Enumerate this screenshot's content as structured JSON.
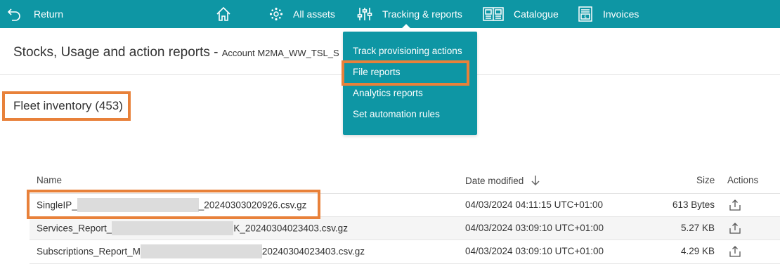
{
  "topbar": {
    "return_label": "Return",
    "home_icon": "home-icon",
    "all_assets_label": "All assets",
    "tracking_label": "Tracking & reports",
    "catalogue_label": "Catalogue",
    "invoices_label": "Invoices",
    "accent_color": "#0e96a4"
  },
  "dropdown": {
    "items": [
      {
        "label": "Track provisioning actions"
      },
      {
        "label": "File reports",
        "highlighted": true
      },
      {
        "label": "Analytics reports"
      },
      {
        "label": "Set automation rules"
      }
    ]
  },
  "page": {
    "title": "Stocks, Usage and action reports",
    "separator": "-",
    "account": "Account M2MA_WW_TSL_S"
  },
  "fleet": {
    "label": "Fleet inventory (453)"
  },
  "table": {
    "columns": {
      "name": "Name",
      "date": "Date modified",
      "size": "Size",
      "actions": "Actions"
    },
    "sort_icon": "arrow-down-icon",
    "rows": [
      {
        "name_prefix": "SingleIP_",
        "name_suffix": "_20240303020926.csv.gz",
        "date": "04/03/2024 04:11:15 UTC+01:00",
        "size": "613 Bytes"
      },
      {
        "name_prefix": "Services_Report_",
        "name_suffix": "K_20240304023403.csv.gz",
        "date": "04/03/2024 03:09:10 UTC+01:00",
        "size": "5.27 KB"
      },
      {
        "name_prefix": "Subscriptions_Report_M",
        "name_suffix": "20240304023403.csv.gz",
        "date": "04/03/2024 03:09:10 UTC+01:00",
        "size": "4.29 KB"
      }
    ]
  },
  "highlight_color": "#e8813a"
}
